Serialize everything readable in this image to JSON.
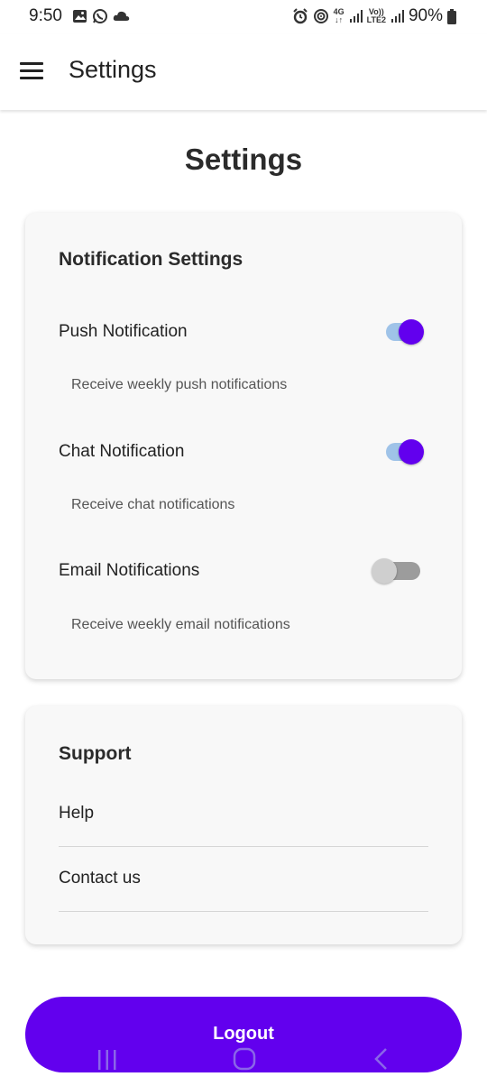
{
  "status_bar": {
    "time": "9:50",
    "battery": "90%",
    "net_4g": "4G",
    "volte": "Vo))",
    "lte2": "LTE2"
  },
  "app_bar": {
    "title": "Settings",
    "menu_icon": "hamburger-menu-icon"
  },
  "page": {
    "title": "Settings"
  },
  "notification_card": {
    "heading": "Notification Settings",
    "items": [
      {
        "label": "Push Notification",
        "description": "Receive weekly push notifications",
        "enabled": true
      },
      {
        "label": "Chat Notification",
        "description": "Receive chat notifications",
        "enabled": true
      },
      {
        "label": "Email Notifications",
        "description": "Receive weekly email notifications",
        "enabled": false
      }
    ]
  },
  "support_card": {
    "heading": "Support",
    "items": [
      {
        "label": "Help"
      },
      {
        "label": "Contact us"
      }
    ]
  },
  "logout": {
    "label": "Logout"
  },
  "colors": {
    "accent": "#6200ee",
    "toggle_track_on": "#9fc3e8",
    "card_bg": "#f8f8f8"
  },
  "nav_bar": {
    "icons": [
      "recent-apps-icon",
      "home-icon",
      "back-icon"
    ]
  }
}
